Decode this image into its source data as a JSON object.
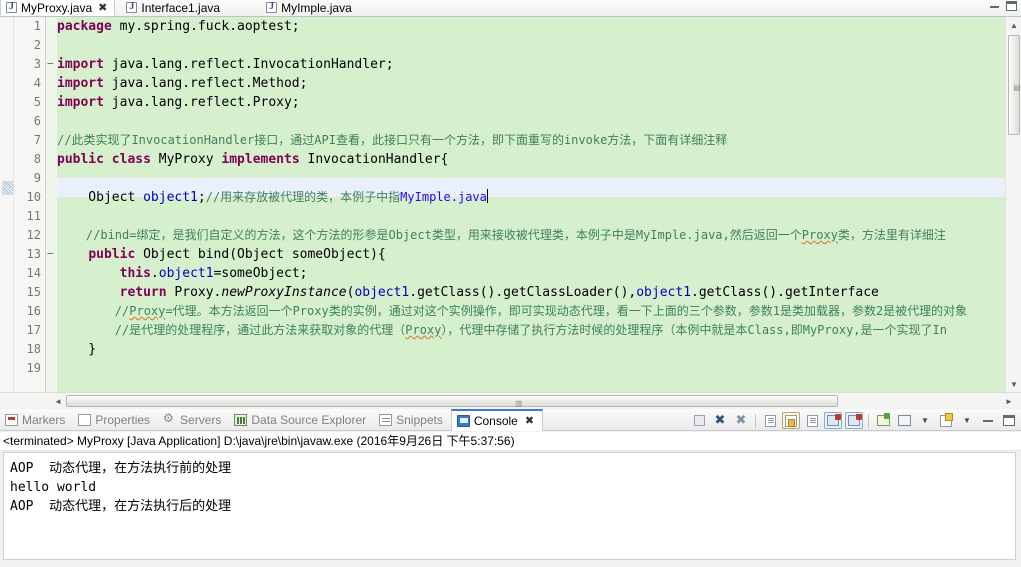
{
  "editor_tabs": [
    {
      "label": "MyProxy.java",
      "active": true,
      "close": "✖",
      "icon": "java-file-icon"
    },
    {
      "label": "Interface1.java",
      "active": false,
      "close": "",
      "icon": "java-file-icon"
    },
    {
      "label": "MyImple.java",
      "active": false,
      "close": "",
      "icon": "java-file-icon"
    }
  ],
  "window_controls": {
    "minimize": "minimize-icon",
    "maximize": "maximize-icon"
  },
  "editor": {
    "line_numbers": [
      "1",
      "2",
      "3",
      "4",
      "5",
      "6",
      "7",
      "8",
      "9",
      "10",
      "11",
      "12",
      "13",
      "14",
      "15",
      "16",
      "17",
      "18",
      "19"
    ],
    "fold_markers": {
      "3": "−",
      "13": "−"
    },
    "current_line": 10,
    "code": [
      "package my.spring.fuck.aoptest;",
      "",
      "import java.lang.reflect.InvocationHandler;",
      "import java.lang.reflect.Method;",
      "import java.lang.reflect.Proxy;",
      "",
      "//此类实现了InvocationHandler接口，通过API查看，此接口只有一个方法，即下面重写的invoke方法，下面有详细注释",
      "public class MyProxy implements InvocationHandler{",
      "",
      "    Object object1;//用来存放被代理的类，本例子中指MyImple.java",
      "",
      "    //bind=绑定，是我们自定义的方法，这个方法的形参是Object类型，用来接收被代理类，本例子中是MyImple.java,然后返回一个Proxy类，方法里有详细注",
      "    public Object bind(Object someObject){",
      "        this.object1=someObject;",
      "        return Proxy.newProxyInstance(object1.getClass().getClassLoader(),object1.getClass().getInterface",
      "        //Proxy=代理。本方法返回一个Proxy类的实例，通过对这个实例操作，即可实现动态代理，看一下上面的三个参数，参数1是类加载器，参数2是被代理的对象",
      "        //是代理的处理程序，通过此方法来获取对象的代理（Proxy），代理中存储了执行方法时候的处理程序（本例中就是本Class,即MyProxy,是一个实现了In",
      "    }",
      ""
    ],
    "scroll": {
      "v_up": "▲",
      "v_down": "▼",
      "v_grip": "▤",
      "h_left": "◄",
      "h_right": "►",
      "h_grip": "▥"
    }
  },
  "bottom_panel": {
    "tabs": [
      {
        "label": "Markers",
        "icon": "markers-icon",
        "active": false
      },
      {
        "label": "Properties",
        "icon": "properties-icon",
        "active": false
      },
      {
        "label": "Servers",
        "icon": "servers-icon",
        "active": false
      },
      {
        "label": "Data Source Explorer",
        "icon": "data-source-explorer-icon",
        "active": false
      },
      {
        "label": "Snippets",
        "icon": "snippets-icon",
        "active": false
      },
      {
        "label": "Console",
        "icon": "console-icon",
        "active": true,
        "close": "✖"
      }
    ],
    "toolbar": [
      {
        "name": "clear-console-button",
        "glyph": "▤"
      },
      {
        "name": "terminate-button",
        "glyph": "✖"
      },
      {
        "name": "remove-all-terminated-button",
        "glyph": "✖"
      },
      {
        "name": "separator-1",
        "glyph": ""
      },
      {
        "name": "display-selected-console-button",
        "glyph": "▤"
      },
      {
        "name": "scroll-lock-button",
        "glyph": "🔒"
      },
      {
        "name": "word-wrap-button",
        "glyph": "▤"
      },
      {
        "name": "pin-console-button",
        "glyph": "▣"
      },
      {
        "name": "close-console-button",
        "glyph": "▣"
      },
      {
        "name": "separator-2",
        "glyph": ""
      },
      {
        "name": "open-console-button",
        "glyph": "▤"
      },
      {
        "name": "display-console-button",
        "glyph": "▤"
      },
      {
        "name": "display-console-dropdown",
        "glyph": "▼"
      },
      {
        "name": "new-console-view-button",
        "glyph": "▤"
      },
      {
        "name": "new-console-dropdown",
        "glyph": "▼"
      },
      {
        "name": "minimize-panel-button",
        "glyph": ""
      },
      {
        "name": "maximize-panel-button",
        "glyph": ""
      }
    ],
    "console_header": "<terminated> MyProxy [Java Application] D:\\java\\jre\\bin\\javaw.exe (2016年9月26日 下午5:37:56)",
    "console_output": [
      "AOP  动态代理，在方法执行前的处理",
      "hello world",
      "AOP  动态代理，在方法执行后的处理"
    ]
  },
  "colors": {
    "code_background": "#d6f0cd",
    "current_line": "#eaeffb",
    "keyword": "#7f0055",
    "comment": "#3f7f5f",
    "field": "#0000c0",
    "active_tab_border": "#3a7bd0"
  }
}
